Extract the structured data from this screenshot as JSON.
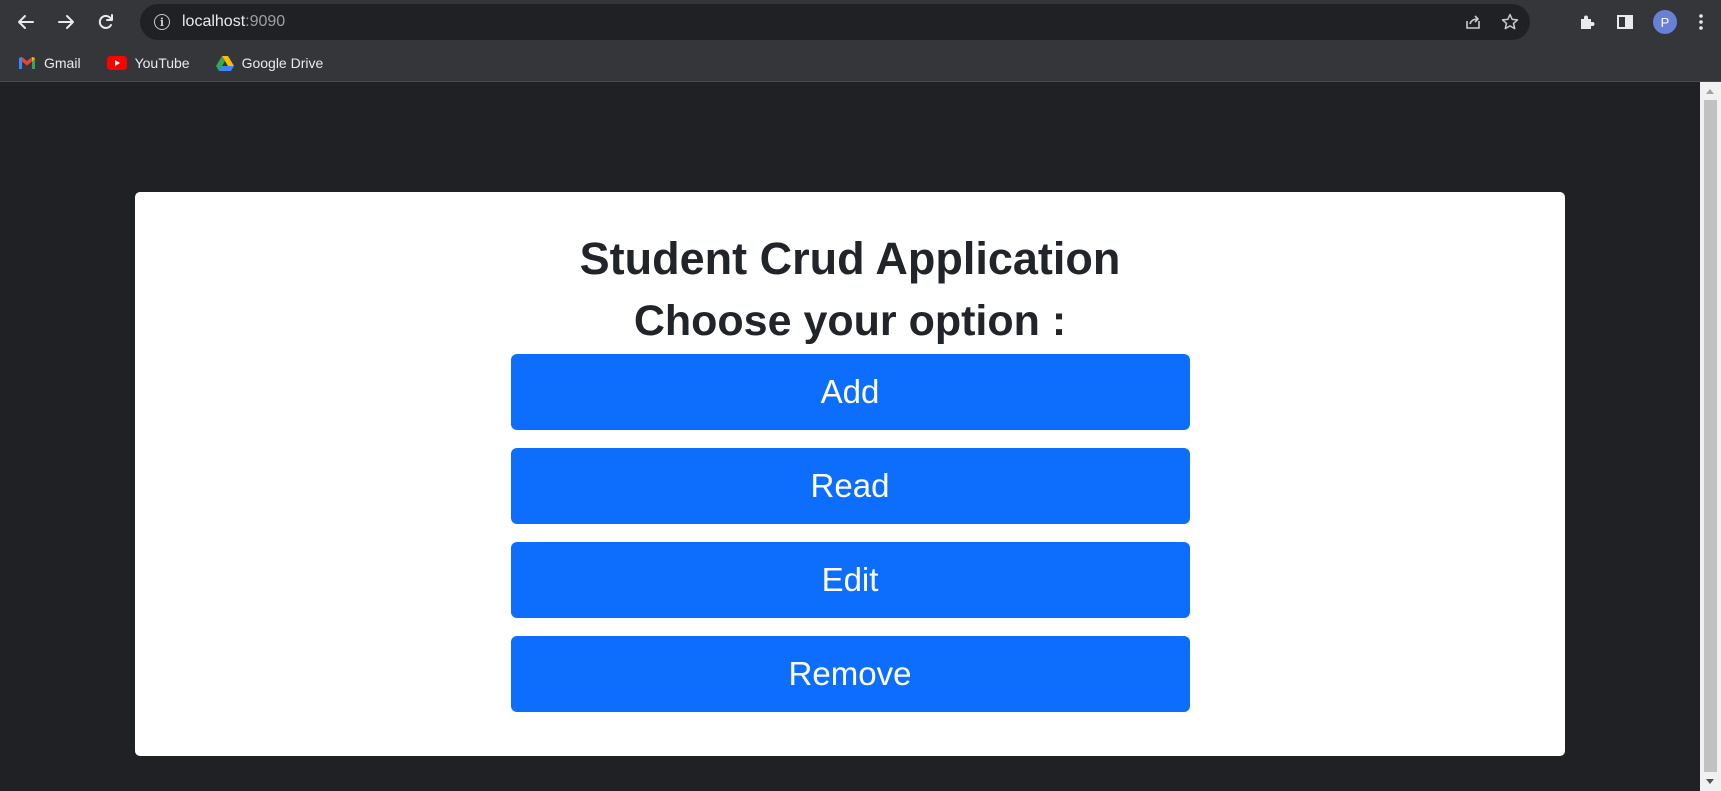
{
  "browser": {
    "url_host": "localhost",
    "url_port": ":9090",
    "profile_initial": "P",
    "bookmarks": [
      {
        "label": "Gmail",
        "icon": "gmail-icon"
      },
      {
        "label": "YouTube",
        "icon": "youtube-icon"
      },
      {
        "label": "Google Drive",
        "icon": "google-drive-icon"
      }
    ]
  },
  "page": {
    "title": "Student Crud Application",
    "subtitle": "Choose your option :",
    "buttons": {
      "add": "Add",
      "read": "Read",
      "edit": "Edit",
      "remove": "Remove"
    }
  },
  "colors": {
    "primary_button": "#0d6efd",
    "page_background": "#202124",
    "card_background": "#ffffff"
  }
}
